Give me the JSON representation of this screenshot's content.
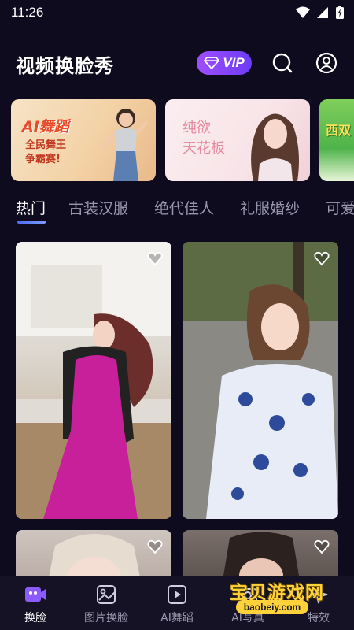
{
  "status_bar": {
    "time": "11:26"
  },
  "header": {
    "title": "视频换脸秀",
    "vip_label": "VIP"
  },
  "banners": [
    {
      "line1": "AI舞蹈",
      "line2": "全民舞王",
      "line3": "争霸赛!"
    },
    {
      "line1": "纯欲",
      "line2": "天花板"
    },
    {
      "line1": "西双"
    }
  ],
  "tabs": [
    "热门",
    "古装汉服",
    "绝代佳人",
    "礼服婚纱",
    "可爱"
  ],
  "active_tab": 0,
  "bottom_nav": {
    "items": [
      {
        "label": "换脸",
        "icon": "video-camera-icon",
        "active": true
      },
      {
        "label": "图片换脸",
        "icon": "image-icon",
        "active": false
      },
      {
        "label": "AI舞蹈",
        "icon": "play-video-icon",
        "active": false
      },
      {
        "label": "AI写真",
        "icon": "camera-icon",
        "active": false
      },
      {
        "label": "特效",
        "icon": "sparkle-icon",
        "active": false
      }
    ]
  },
  "watermark": {
    "text": "宝贝游戏网",
    "url": "baobeiy.com"
  },
  "colors": {
    "background": "#0e0b1e",
    "accent": "#6c3cf5",
    "tab_underline": "#4a6bff",
    "nav_active": "#8a5cff"
  }
}
